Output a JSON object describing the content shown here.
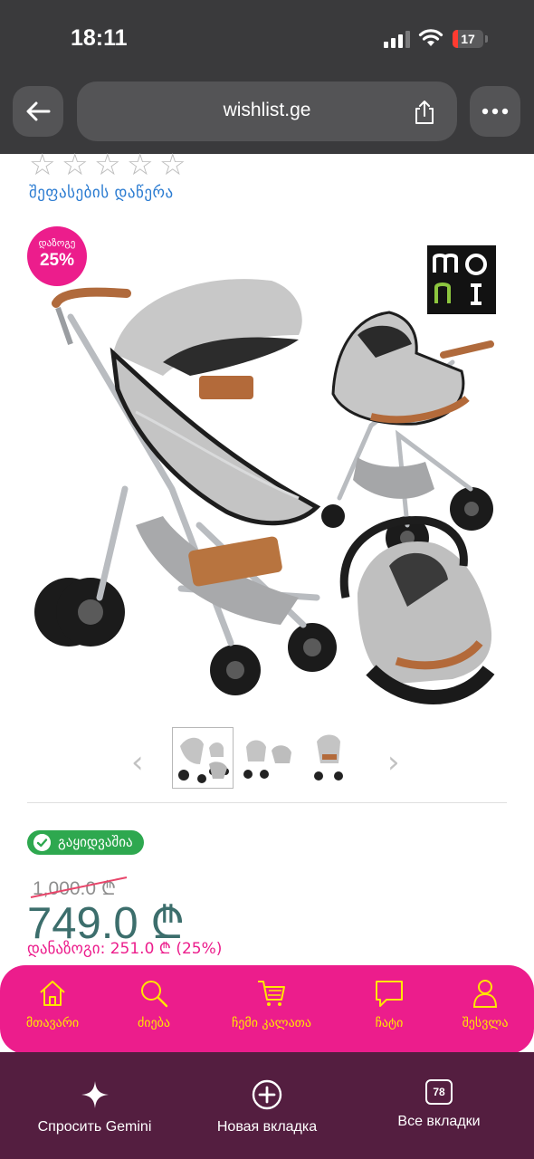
{
  "status_bar": {
    "time": "18:11",
    "battery_level": "17",
    "icons": [
      "signal-icon",
      "wifi-icon",
      "battery-icon"
    ]
  },
  "browser": {
    "url": "wishlist.ge",
    "icons": [
      "back-arrow-icon",
      "share-icon",
      "more-dots-icon"
    ]
  },
  "rating": {
    "stars": 0,
    "max": 5,
    "review_link": "შეფასების დაწერა"
  },
  "product": {
    "discount_label": "დაზოგე",
    "discount_value": "25%",
    "brand_logo_text": "MONI",
    "colors": {
      "accent": "#ec1d8c",
      "price": "#3c6e6c",
      "in_stock": "#2ea84f",
      "nav_text": "#ffe600"
    }
  },
  "gallery": {
    "thumbnails": [
      "thumbnail-1",
      "thumbnail-2",
      "thumbnail-3"
    ],
    "selected_index": 0
  },
  "availability": {
    "label": "გაყიდვაშია"
  },
  "pricing": {
    "old_price": "1,000.0 ₾",
    "price": "749.0 ₾",
    "savings": "დანაზოგი: 251.0 ₾ (25%)"
  },
  "bottom_nav": {
    "items": [
      {
        "icon": "home-icon",
        "label": "მთავარი"
      },
      {
        "icon": "search-icon",
        "label": "ძიება"
      },
      {
        "icon": "cart-icon",
        "label": "ჩემი კალათა"
      },
      {
        "icon": "chat-icon",
        "label": "ჩატი"
      },
      {
        "icon": "user-icon",
        "label": "შესვლა"
      }
    ]
  },
  "browser_bottom": {
    "items": [
      {
        "icon": "gemini-sparkle-icon",
        "label": "Спросить Gemini"
      },
      {
        "icon": "new-tab-plus-icon",
        "label": "Новая вкладка"
      },
      {
        "icon": "tabs-icon",
        "label": "Все вкладки",
        "count": "78"
      }
    ]
  }
}
